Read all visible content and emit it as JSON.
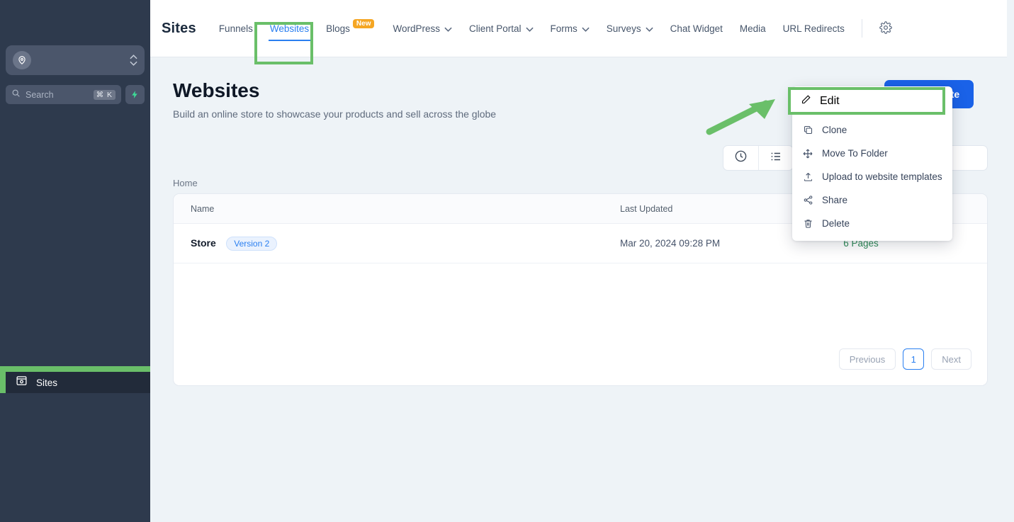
{
  "sidebar": {
    "account_avatar_icon": "location-pin-avatar-icon",
    "account_chevrons_icon": "chevron-up-down-icon",
    "search": {
      "placeholder": "Search",
      "shortcut": "⌘ K",
      "icon": "search-icon"
    },
    "quick_action_icon": "lightning-bolt-icon",
    "active_item": {
      "label": "Sites",
      "icon": "sites-window-icon"
    }
  },
  "topbar": {
    "brand": "Sites",
    "settings_icon": "gear-icon",
    "nav": [
      {
        "label": "Funnels",
        "has_caret": false,
        "active": false,
        "badge": null
      },
      {
        "label": "Websites",
        "has_caret": false,
        "active": true,
        "badge": null
      },
      {
        "label": "Blogs",
        "has_caret": false,
        "active": false,
        "badge": "New"
      },
      {
        "label": "WordPress",
        "has_caret": true,
        "active": false,
        "badge": null
      },
      {
        "label": "Client Portal",
        "has_caret": true,
        "active": false,
        "badge": null
      },
      {
        "label": "Forms",
        "has_caret": true,
        "active": false,
        "badge": null
      },
      {
        "label": "Surveys",
        "has_caret": true,
        "active": false,
        "badge": null
      },
      {
        "label": "Chat Widget",
        "has_caret": false,
        "active": false,
        "badge": null
      },
      {
        "label": "Media",
        "has_caret": false,
        "active": false,
        "badge": null
      },
      {
        "label": "URL Redirects",
        "has_caret": false,
        "active": false,
        "badge": null
      }
    ]
  },
  "page": {
    "title": "Websites",
    "subtitle": "Build an online store to showcase your products and sell across the globe",
    "new_button_label": "New Website",
    "breadcrumb": "Home"
  },
  "toolbar": {
    "recent_view_icon": "clock-icon",
    "list_view_icon": "list-icon",
    "search_placeholder": ""
  },
  "table": {
    "columns": [
      "Name",
      "Last Updated",
      "",
      ""
    ],
    "rows": [
      {
        "name": "Store",
        "version_chip": "Version 2",
        "last_updated": "Mar 20, 2024 09:28 PM",
        "pages": "6 Pages",
        "actions_icon": "kebab-menu-icon"
      }
    ]
  },
  "pagination": {
    "previous": "Previous",
    "current_page": "1",
    "next": "Next"
  },
  "context_menu": {
    "items": [
      {
        "label": "Edit",
        "icon": "pencil-icon",
        "highlighted": true
      },
      {
        "label": "Clone",
        "icon": "copy-icon",
        "highlighted": false
      },
      {
        "label": "Move To Folder",
        "icon": "move-icon",
        "highlighted": false
      },
      {
        "label": "Upload to website templates",
        "icon": "upload-icon",
        "highlighted": false
      },
      {
        "label": "Share",
        "icon": "share-icon",
        "highlighted": false
      },
      {
        "label": "Delete",
        "icon": "trash-icon",
        "highlighted": false
      }
    ]
  },
  "annotations": {
    "highlight_color": "#6abf69",
    "arrow_icon": "green-pointer-arrow",
    "highlighted_targets": [
      "sidebar-item-sites",
      "tab-websites",
      "row-actions-kebab-button",
      "menu-item-edit"
    ]
  },
  "colors": {
    "sidebar_bg": "#2e3a4d",
    "accent_blue": "#2a7ff0",
    "primary_button": "#1a62e8",
    "badge_amber": "#f5a623",
    "pages_green": "#2e8b57",
    "page_bg": "#eef3f7"
  }
}
